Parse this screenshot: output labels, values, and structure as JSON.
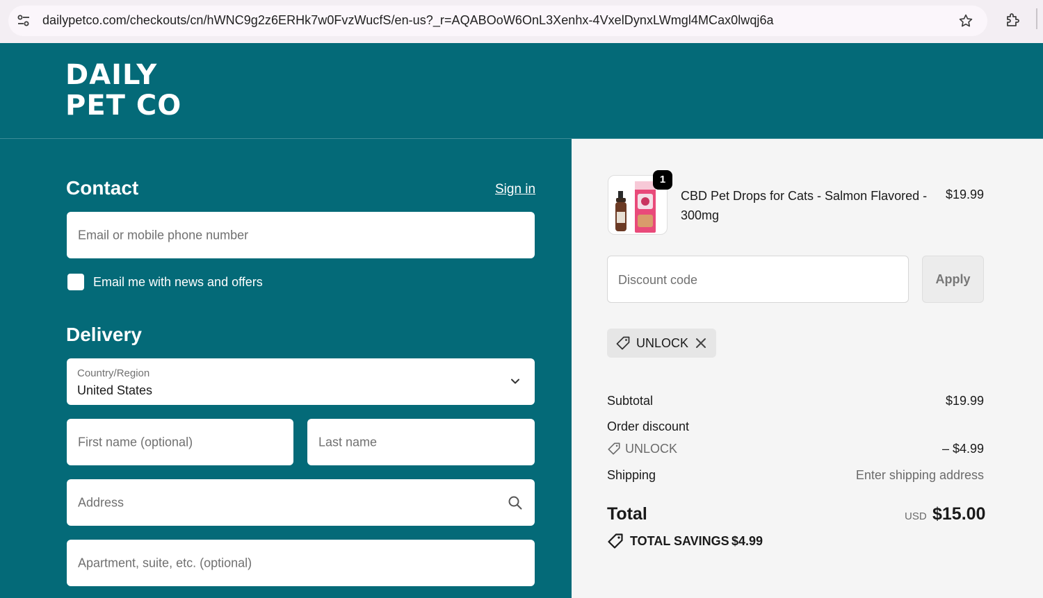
{
  "browser": {
    "url": "dailypetco.com/checkouts/cn/hWNC9g2z6ERHk7w0FvzWucfS/en-us?_r=AQABOoW6OnL3Xenhx-4VxelDynxLWmgl4MCax0lwqj6a",
    "icons": [
      "site-settings-icon",
      "bookmark-star-icon",
      "extensions-icon"
    ]
  },
  "header": {
    "logo_line1": "DAILY",
    "logo_line2": "PET CO",
    "background": "#046a78"
  },
  "contact": {
    "title": "Contact",
    "sign_in": "Sign in",
    "email_placeholder": "Email or mobile phone number",
    "newsletter_label": "Email me with news and offers",
    "newsletter_checked": false
  },
  "delivery": {
    "title": "Delivery",
    "country_label": "Country/Region",
    "country_value": "United States",
    "first_name_placeholder": "First name (optional)",
    "last_name_placeholder": "Last name",
    "address_placeholder": "Address",
    "apartment_placeholder": "Apartment, suite, etc. (optional)"
  },
  "cart": {
    "item": {
      "quantity": "1",
      "name": "CBD Pet Drops for Cats - Salmon Flavored - 300mg",
      "price": "$19.99"
    },
    "discount_placeholder": "Discount code",
    "apply_label": "Apply",
    "applied_code": "UNLOCK"
  },
  "summary": {
    "subtotal_label": "Subtotal",
    "subtotal_value": "$19.99",
    "discount_label": "Order discount",
    "discount_code": "UNLOCK",
    "discount_value": "– $4.99",
    "shipping_label": "Shipping",
    "shipping_value": "Enter shipping address",
    "total_label": "Total",
    "currency": "USD",
    "total_value": "$15.00",
    "savings_label": "TOTAL SAVINGS",
    "savings_value": "$4.99"
  }
}
